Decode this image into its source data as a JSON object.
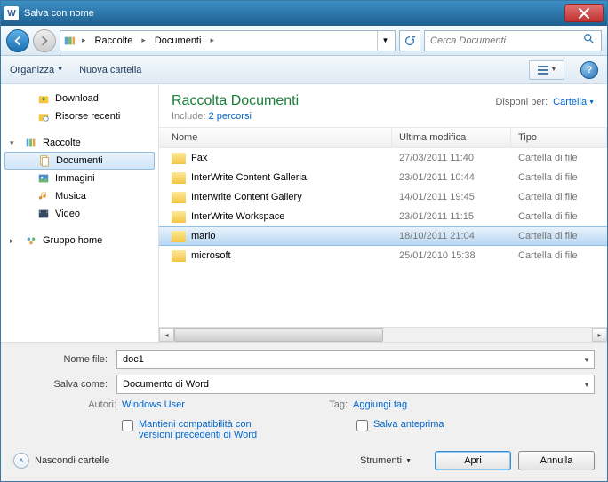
{
  "titlebar": {
    "title": "Salva con nome"
  },
  "breadcrumb": {
    "items": [
      "Raccolte",
      "Documenti"
    ]
  },
  "search": {
    "placeholder": "Cerca Documenti"
  },
  "toolbar": {
    "organize": "Organizza",
    "new_folder": "Nuova cartella"
  },
  "sidebar": {
    "download": "Download",
    "recent": "Risorse recenti",
    "libraries": "Raccolte",
    "documents": "Documenti",
    "images": "Immagini",
    "music": "Musica",
    "video": "Video",
    "homegroup": "Gruppo home"
  },
  "library": {
    "title": "Raccolta Documenti",
    "include_label": "Include:",
    "include_link": "2 percorsi",
    "arrange_label": "Disponi per:",
    "arrange_value": "Cartella"
  },
  "columns": {
    "name": "Nome",
    "modified": "Ultima modifica",
    "type": "Tipo"
  },
  "rows": [
    {
      "name": "Fax",
      "date": "27/03/2011 11:40",
      "type": "Cartella di file",
      "selected": false
    },
    {
      "name": "InterWrite Content Galleria",
      "date": "23/01/2011 10:44",
      "type": "Cartella di file",
      "selected": false
    },
    {
      "name": "Interwrite Content Gallery",
      "date": "14/01/2011 19:45",
      "type": "Cartella di file",
      "selected": false
    },
    {
      "name": "InterWrite Workspace",
      "date": "23/01/2011 11:15",
      "type": "Cartella di file",
      "selected": false
    },
    {
      "name": "mario",
      "date": "18/10/2011 21:04",
      "type": "Cartella di file",
      "selected": true
    },
    {
      "name": "microsoft",
      "date": "25/01/2010 15:38",
      "type": "Cartella di file",
      "selected": false
    }
  ],
  "form": {
    "filename_label": "Nome file:",
    "filename_value": "doc1",
    "saveas_label": "Salva come:",
    "saveas_value": "Documento di Word",
    "authors_label": "Autori:",
    "authors_value": "Windows User",
    "tags_label": "Tag:",
    "tags_value": "Aggiungi tag",
    "compat_label": "Mantieni compatibilità con versioni precedenti di Word",
    "thumb_label": "Salva anteprima"
  },
  "buttons": {
    "hide_folders": "Nascondi cartelle",
    "tools": "Strumenti",
    "open": "Apri",
    "cancel": "Annulla"
  }
}
